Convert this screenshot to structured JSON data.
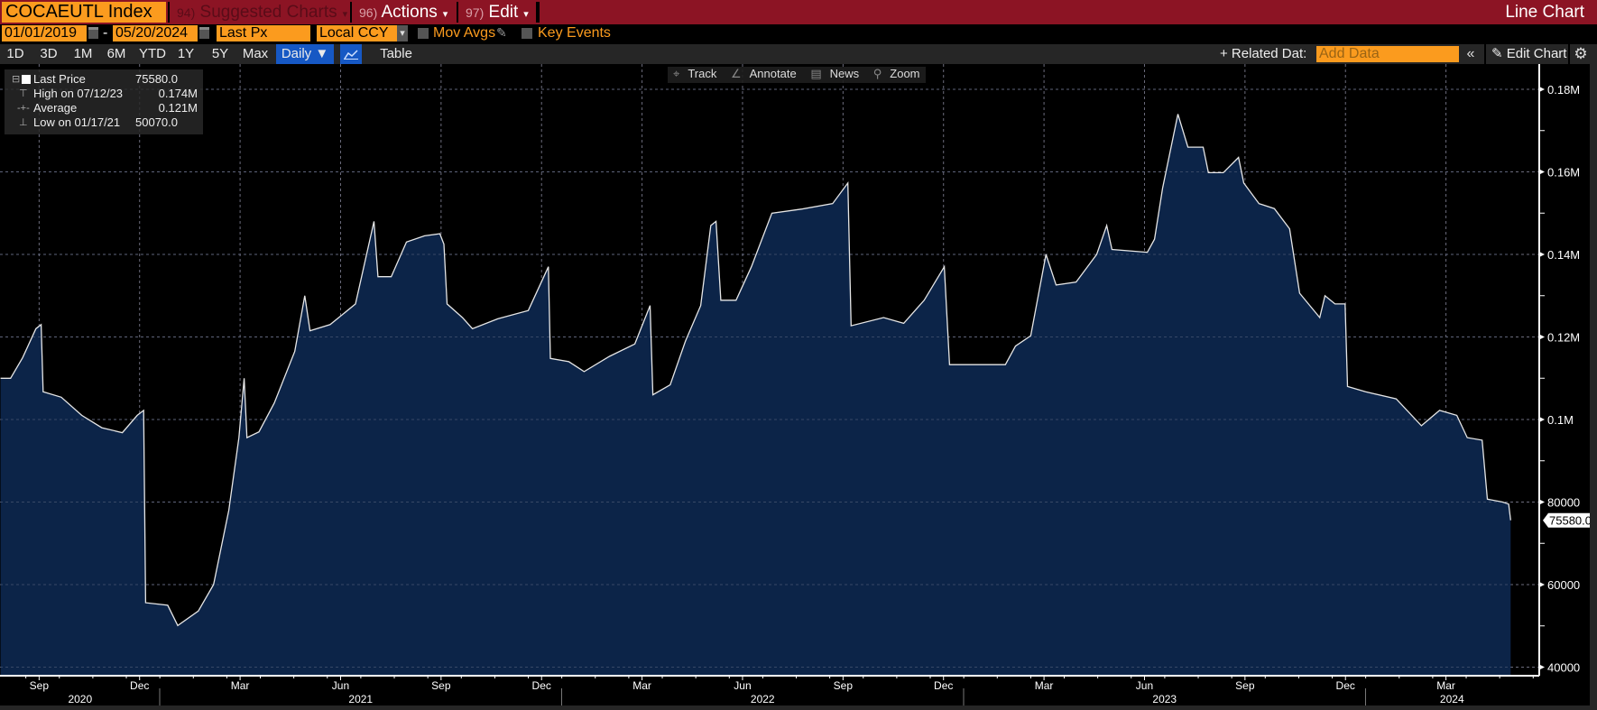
{
  "header": {
    "ticker": "COCAEUTL Index",
    "suggested_num": "94)",
    "suggested_label": "Suggested Charts",
    "actions_num": "96)",
    "actions_label": "Actions",
    "edit_num": "97)",
    "edit_label": "Edit",
    "caret": "▾",
    "chart_type": "Line Chart"
  },
  "controls": {
    "start_date": "01/01/2019",
    "date_sep": "-",
    "end_date": "05/20/2024",
    "field": "Last Px",
    "currency": "Local CCY",
    "dropdown_arrow": "▾",
    "mov_avgs": "Mov Avgs",
    "key_events": "Key Events"
  },
  "periods": [
    "1D",
    "3D",
    "1M",
    "6M",
    "YTD",
    "1Y",
    "5Y",
    "Max"
  ],
  "frequency": "Daily ▼",
  "table_label": "Table",
  "right_toolbar": {
    "related": "+ Related Dat:",
    "add_data_placeholder": "Add Data",
    "collapse": "«",
    "edit_chart": "Edit Chart"
  },
  "chart_tools": [
    "Track",
    "Annotate",
    "News",
    "Zoom"
  ],
  "legend": [
    {
      "label": "Last Price",
      "value": "75580.0"
    },
    {
      "label": "High on 07/12/23",
      "value": "0.174M"
    },
    {
      "label": "Average",
      "value": "0.121M"
    },
    {
      "label": "Low on 01/17/21",
      "value": "50070.0"
    }
  ],
  "colors": {
    "fill": "#0c2448",
    "line": "#e6e6e6",
    "accent": "#fb9b1e",
    "header": "#8c1424",
    "active": "#1658c4"
  },
  "chart_data": {
    "type": "area",
    "title": "COCAEUTL Index",
    "last_value_label": "75580.0",
    "last_value": 75580,
    "xlim": [
      2020.604,
      2024.43
    ],
    "ylim": [
      37800,
      185900
    ],
    "grid": true,
    "x_unit": "decimal year",
    "x": [
      2020.604,
      2020.629,
      2020.659,
      2020.692,
      2020.705,
      2020.71,
      2020.755,
      2020.806,
      2020.856,
      2020.907,
      2020.944,
      2020.96,
      2020.965,
      2021.02,
      2021.045,
      2021.096,
      2021.134,
      2021.172,
      2021.197,
      2021.21,
      2021.217,
      2021.247,
      2021.285,
      2021.336,
      2021.361,
      2021.374,
      2021.424,
      2021.487,
      2021.533,
      2021.543,
      2021.576,
      2021.614,
      2021.659,
      2021.697,
      2021.707,
      2021.715,
      2021.753,
      2021.778,
      2021.841,
      2021.917,
      2021.967,
      2021.972,
      2022.018,
      2022.056,
      2022.119,
      2022.182,
      2022.22,
      2022.227,
      2022.27,
      2022.308,
      2022.346,
      2022.371,
      2022.384,
      2022.396,
      2022.434,
      2022.472,
      2022.523,
      2022.598,
      2022.674,
      2022.712,
      2022.72,
      2022.801,
      2022.851,
      2022.902,
      2022.952,
      2022.965,
      2023.104,
      2023.129,
      2023.167,
      2023.205,
      2023.23,
      2023.28,
      2023.331,
      2023.356,
      2023.369,
      2023.457,
      2023.475,
      2023.495,
      2023.533,
      2023.558,
      2023.596,
      2023.609,
      2023.646,
      2023.684,
      2023.697,
      2023.735,
      2023.773,
      2023.811,
      2023.836,
      2023.886,
      2023.899,
      2023.924,
      2023.949,
      2023.955,
      2024.0,
      2024.076,
      2024.139,
      2024.184,
      2024.227,
      2024.253,
      2024.29,
      2024.303,
      2024.341,
      2024.356,
      2024.361
    ],
    "y": [
      110000,
      110000,
      115000,
      122000,
      123000,
      106700,
      105400,
      101000,
      98000,
      96800,
      101000,
      102200,
      55600,
      55000,
      50070,
      53600,
      60000,
      78000,
      95600,
      110000,
      95600,
      97000,
      104000,
      116500,
      130000,
      121500,
      123000,
      128000,
      148000,
      134600,
      134600,
      143000,
      144500,
      145000,
      142500,
      128000,
      124700,
      122000,
      124400,
      126400,
      137000,
      114800,
      114000,
      111600,
      115300,
      118300,
      127600,
      106000,
      108400,
      119000,
      127600,
      147000,
      148000,
      128900,
      128900,
      137000,
      150000,
      151000,
      152300,
      157300,
      122700,
      124700,
      123300,
      128900,
      137000,
      113300,
      113300,
      117800,
      120300,
      140000,
      132600,
      133300,
      140000,
      147000,
      141200,
      140500,
      143700,
      156000,
      174000,
      166000,
      166000,
      159800,
      159800,
      163500,
      157300,
      152300,
      151100,
      146200,
      130600,
      124700,
      130000,
      128000,
      128000,
      108000,
      106700,
      105000,
      98500,
      102200,
      101000,
      95600,
      95000,
      80700,
      80000,
      79500,
      75580
    ],
    "y_ticks": [
      {
        "value": 180000,
        "label": "0.18M"
      },
      {
        "value": 160000,
        "label": "0.16M"
      },
      {
        "value": 140000,
        "label": "0.14M"
      },
      {
        "value": 120000,
        "label": "0.12M"
      },
      {
        "value": 100000,
        "label": "0.1M"
      },
      {
        "value": 80000,
        "label": "80000"
      },
      {
        "value": 60000,
        "label": "60000"
      },
      {
        "value": 40000,
        "label": "40000"
      }
    ],
    "x_month_ticks": [
      {
        "pos": 2020.7,
        "label": "Sep"
      },
      {
        "pos": 2020.95,
        "label": "Dec"
      },
      {
        "pos": 2021.2,
        "label": "Mar"
      },
      {
        "pos": 2021.45,
        "label": "Jun"
      },
      {
        "pos": 2021.7,
        "label": "Sep"
      },
      {
        "pos": 2021.95,
        "label": "Dec"
      },
      {
        "pos": 2022.2,
        "label": "Mar"
      },
      {
        "pos": 2022.45,
        "label": "Jun"
      },
      {
        "pos": 2022.7,
        "label": "Sep"
      },
      {
        "pos": 2022.95,
        "label": "Dec"
      },
      {
        "pos": 2023.2,
        "label": "Mar"
      },
      {
        "pos": 2023.45,
        "label": "Jun"
      },
      {
        "pos": 2023.7,
        "label": "Sep"
      },
      {
        "pos": 2023.95,
        "label": "Dec"
      },
      {
        "pos": 2024.2,
        "label": "Mar"
      }
    ],
    "x_year_ticks": [
      {
        "start": 2020.604,
        "end": 2021.0,
        "label": "2020"
      },
      {
        "start": 2021.0,
        "end": 2022.0,
        "label": "2021"
      },
      {
        "start": 2022.0,
        "end": 2023.0,
        "label": "2022"
      },
      {
        "start": 2023.0,
        "end": 2024.0,
        "label": "2023"
      },
      {
        "start": 2024.0,
        "end": 2024.43,
        "label": "2024"
      }
    ]
  }
}
